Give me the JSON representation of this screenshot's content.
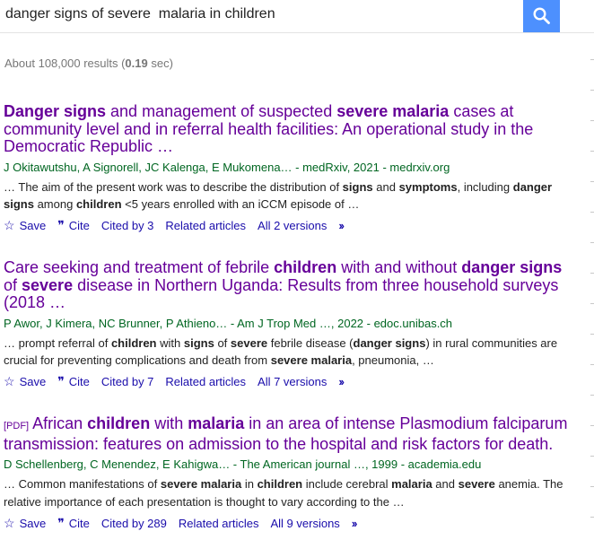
{
  "search": {
    "query": "danger signs of severe  malaria in children"
  },
  "stats": {
    "prefix": "About 108,000 results (",
    "time": "0.19",
    "suffix": " sec)"
  },
  "actions": {
    "save": "Save",
    "cite": "Cite",
    "related": "Related articles",
    "more_icon": "double-chevron-icon",
    "save_icon": "star-icon",
    "cite_icon": "quote-icon"
  },
  "results": [
    {
      "title": [
        {
          "t": "Danger signs",
          "b": true
        },
        {
          "t": " and management of suspected ",
          "b": false
        },
        {
          "t": "severe malaria",
          "b": true
        },
        {
          "t": " cases at community level and in referral health facilities: An operational study in the Democratic Republic …",
          "b": false
        }
      ],
      "authors": "J Okitawutshu, A Signorell, JC Kalenga, E Mukomena… - medRxiv, 2021 - medrxiv.org",
      "snippet": [
        {
          "t": "… The aim of the present work was to describe the distribution of ",
          "b": false
        },
        {
          "t": "signs",
          "b": true
        },
        {
          "t": " and ",
          "b": false
        },
        {
          "t": "symptoms",
          "b": true
        },
        {
          "t": ", including ",
          "b": false
        },
        {
          "t": "danger signs",
          "b": true
        },
        {
          "t": " among ",
          "b": false
        },
        {
          "t": "children",
          "b": true
        },
        {
          "t": " <5 years enrolled with an iCCM episode of …",
          "b": false
        }
      ],
      "cited": "Cited by 3",
      "versions": "All 2 versions"
    },
    {
      "title": [
        {
          "t": "Care seeking and treatment of febrile ",
          "b": false
        },
        {
          "t": "children",
          "b": true
        },
        {
          "t": " with and without ",
          "b": false
        },
        {
          "t": "danger signs",
          "b": true
        },
        {
          "t": " of ",
          "b": false
        },
        {
          "t": "severe",
          "b": true
        },
        {
          "t": " disease in Northern Uganda: Results from three household surveys (2018 …",
          "b": false
        }
      ],
      "authors": "P Awor, J Kimera, NC Brunner, P Athieno… - Am J Trop Med …, 2022 - edoc.unibas.ch",
      "snippet": [
        {
          "t": "… prompt referral of ",
          "b": false
        },
        {
          "t": "children",
          "b": true
        },
        {
          "t": " with ",
          "b": false
        },
        {
          "t": "signs",
          "b": true
        },
        {
          "t": " of ",
          "b": false
        },
        {
          "t": "severe",
          "b": true
        },
        {
          "t": " febrile disease (",
          "b": false
        },
        {
          "t": "danger signs",
          "b": true
        },
        {
          "t": ") in rural communities are crucial for preventing complications and death from ",
          "b": false
        },
        {
          "t": "severe malaria",
          "b": true
        },
        {
          "t": ", pneumonia, …",
          "b": false
        }
      ],
      "cited": "Cited by 7",
      "versions": "All 7 versions"
    },
    {
      "pdf": "[PDF]",
      "title": [
        {
          "t": "African ",
          "b": false
        },
        {
          "t": "children",
          "b": true
        },
        {
          "t": " with ",
          "b": false
        },
        {
          "t": "malaria",
          "b": true
        },
        {
          "t": " in an area of intense Plasmodium falciparum transmission: features on admission to the hospital and risk factors for death.",
          "b": false
        }
      ],
      "authors": "D Schellenberg, C Menendez, E Kahigwa… - The American journal …, 1999 - academia.edu",
      "snippet": [
        {
          "t": "… Common manifestations of ",
          "b": false
        },
        {
          "t": "severe malaria",
          "b": true
        },
        {
          "t": " in ",
          "b": false
        },
        {
          "t": "children",
          "b": true
        },
        {
          "t": " include cerebral ",
          "b": false
        },
        {
          "t": "malaria",
          "b": true
        },
        {
          "t": " and ",
          "b": false
        },
        {
          "t": "severe",
          "b": true
        },
        {
          "t": " anemia. The relative importance of each presentation is thought to vary according to the …",
          "b": false
        }
      ],
      "cited": "Cited by 289",
      "versions": "All 9 versions"
    }
  ]
}
